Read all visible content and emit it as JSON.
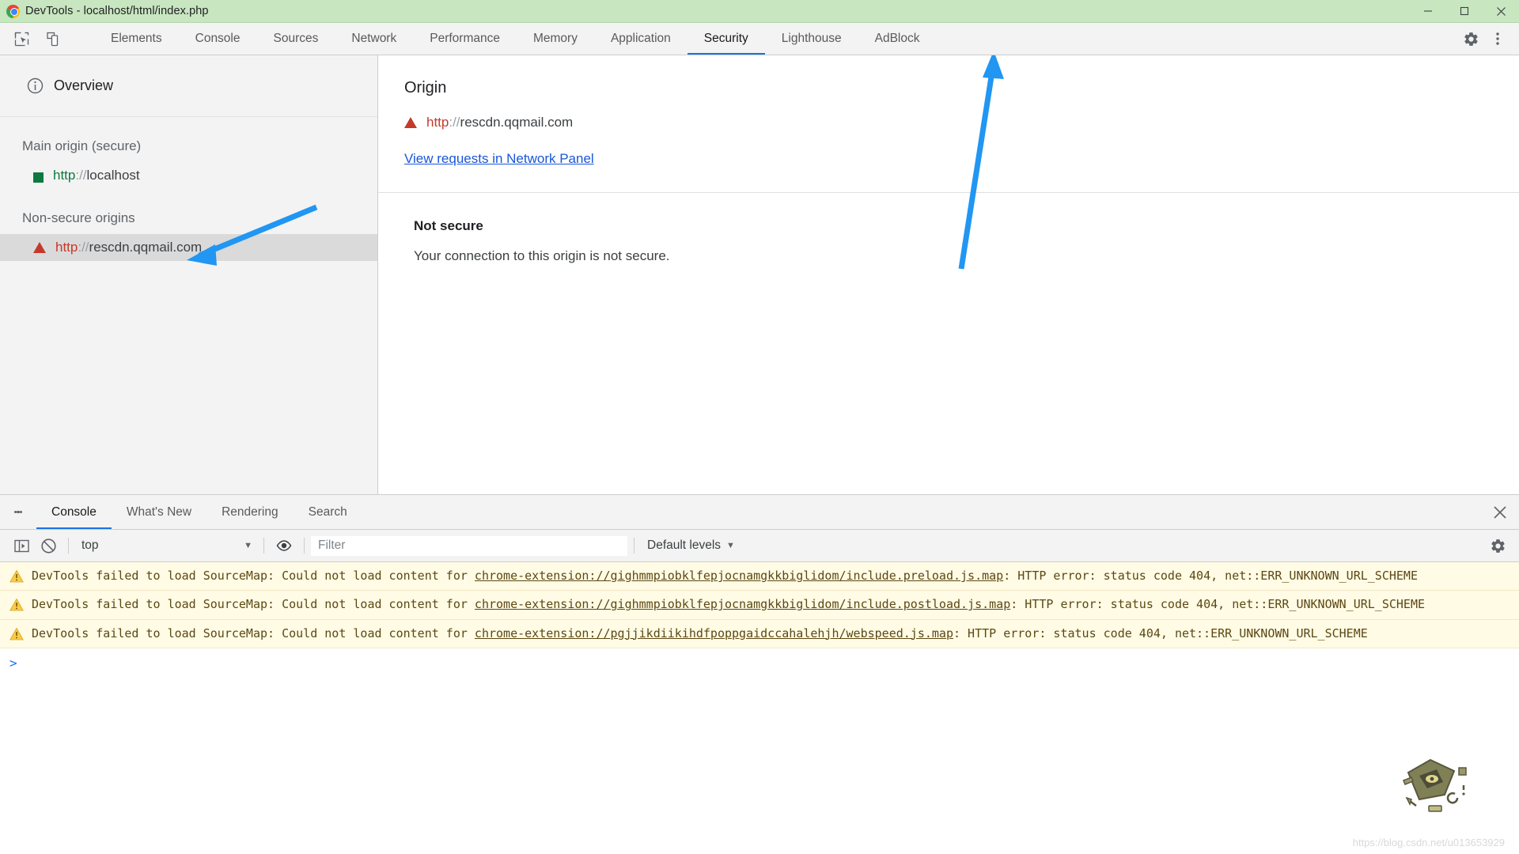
{
  "window": {
    "title": "DevTools - localhost/html/index.php",
    "logo_icon": "chrome-logo-icon",
    "minimize_label": "Minimize",
    "maximize_label": "Maximize",
    "close_label": "Close"
  },
  "toolbar": {
    "inspect_icon": "inspect-element-icon",
    "device_icon": "device-toolbar-icon",
    "settings_icon": "gear-icon",
    "more_icon": "more-vertical-icon",
    "tabs": [
      {
        "label": "Elements",
        "active": false
      },
      {
        "label": "Console",
        "active": false
      },
      {
        "label": "Sources",
        "active": false
      },
      {
        "label": "Network",
        "active": false
      },
      {
        "label": "Performance",
        "active": false
      },
      {
        "label": "Memory",
        "active": false
      },
      {
        "label": "Application",
        "active": false
      },
      {
        "label": "Security",
        "active": true
      },
      {
        "label": "Lighthouse",
        "active": false
      },
      {
        "label": "AdBlock",
        "active": false
      }
    ]
  },
  "sidebar": {
    "overview_label": "Overview",
    "overview_icon": "info-circle-icon",
    "groups": [
      {
        "title": "Main origin (secure)",
        "origins": [
          {
            "badge_icon": "secure-square-icon",
            "badge_color": "#0c7a3e",
            "scheme": "http",
            "separator": "://",
            "host": "localhost",
            "secure": true,
            "selected": false
          }
        ]
      },
      {
        "title": "Non-secure origins",
        "origins": [
          {
            "badge_icon": "warning-triangle-icon",
            "badge_color": "#c5392b",
            "scheme": "http",
            "separator": "://",
            "host": "rescdn.qqmail.com",
            "secure": false,
            "selected": true
          }
        ]
      }
    ]
  },
  "main": {
    "origin_heading": "Origin",
    "origin": {
      "badge_icon": "warning-triangle-icon",
      "scheme": "http",
      "separator": "://",
      "host": "rescdn.qqmail.com"
    },
    "network_link": "View requests in Network Panel",
    "connection_title": "Not secure",
    "connection_text": "Your connection to this origin is not secure."
  },
  "drawer": {
    "menu_icon": "more-vertical-icon",
    "close_icon": "close-icon",
    "tabs": [
      {
        "label": "Console",
        "active": true
      },
      {
        "label": "What's New",
        "active": false
      },
      {
        "label": "Rendering",
        "active": false
      },
      {
        "label": "Search",
        "active": false
      }
    ],
    "console_toolbar": {
      "sidebar_icon": "console-sidebar-icon",
      "clear_icon": "clear-console-icon",
      "context_value": "top",
      "context_caret": "▼",
      "eye_icon": "eye-icon",
      "filter_placeholder": "Filter",
      "filter_value": "",
      "levels_label": "Default levels",
      "levels_caret": "▼",
      "settings_icon": "gear-icon"
    },
    "messages": [
      {
        "level": "warning",
        "icon": "warning-triangle-icon",
        "prefix": "DevTools failed to load SourceMap: Could not load content for ",
        "link": "chrome-extension://gighmmpiobklfepjocnamgkkbiglidom/include.preload.js.map",
        "suffix": ": HTTP error: status code 404, net::ERR_UNKNOWN_URL_SCHEME"
      },
      {
        "level": "warning",
        "icon": "warning-triangle-icon",
        "prefix": "DevTools failed to load SourceMap: Could not load content for ",
        "link": "chrome-extension://gighmmpiobklfepjocnamgkkbiglidom/include.postload.js.map",
        "suffix": ": HTTP error: status code 404, net::ERR_UNKNOWN_URL_SCHEME"
      },
      {
        "level": "warning",
        "icon": "warning-triangle-icon",
        "prefix": "DevTools failed to load SourceMap: Could not load content for ",
        "link": "chrome-extension://pgjjikdiikihdfpoppgaidccahalehjh/webspeed.js.map",
        "suffix": ": HTTP error: status code 404, net::ERR_UNKNOWN_URL_SCHEME"
      }
    ],
    "prompt_caret": ">",
    "prompt_value": ""
  },
  "watermark": "https://blog.csdn.net/u013653929",
  "colors": {
    "accent": "#1a73e8",
    "secure": "#0c7a3e",
    "insecure": "#c5392b",
    "titlebar": "#c8e6c0",
    "warning_bg": "#fffbe5",
    "annotation_arrow": "#2196f3"
  }
}
